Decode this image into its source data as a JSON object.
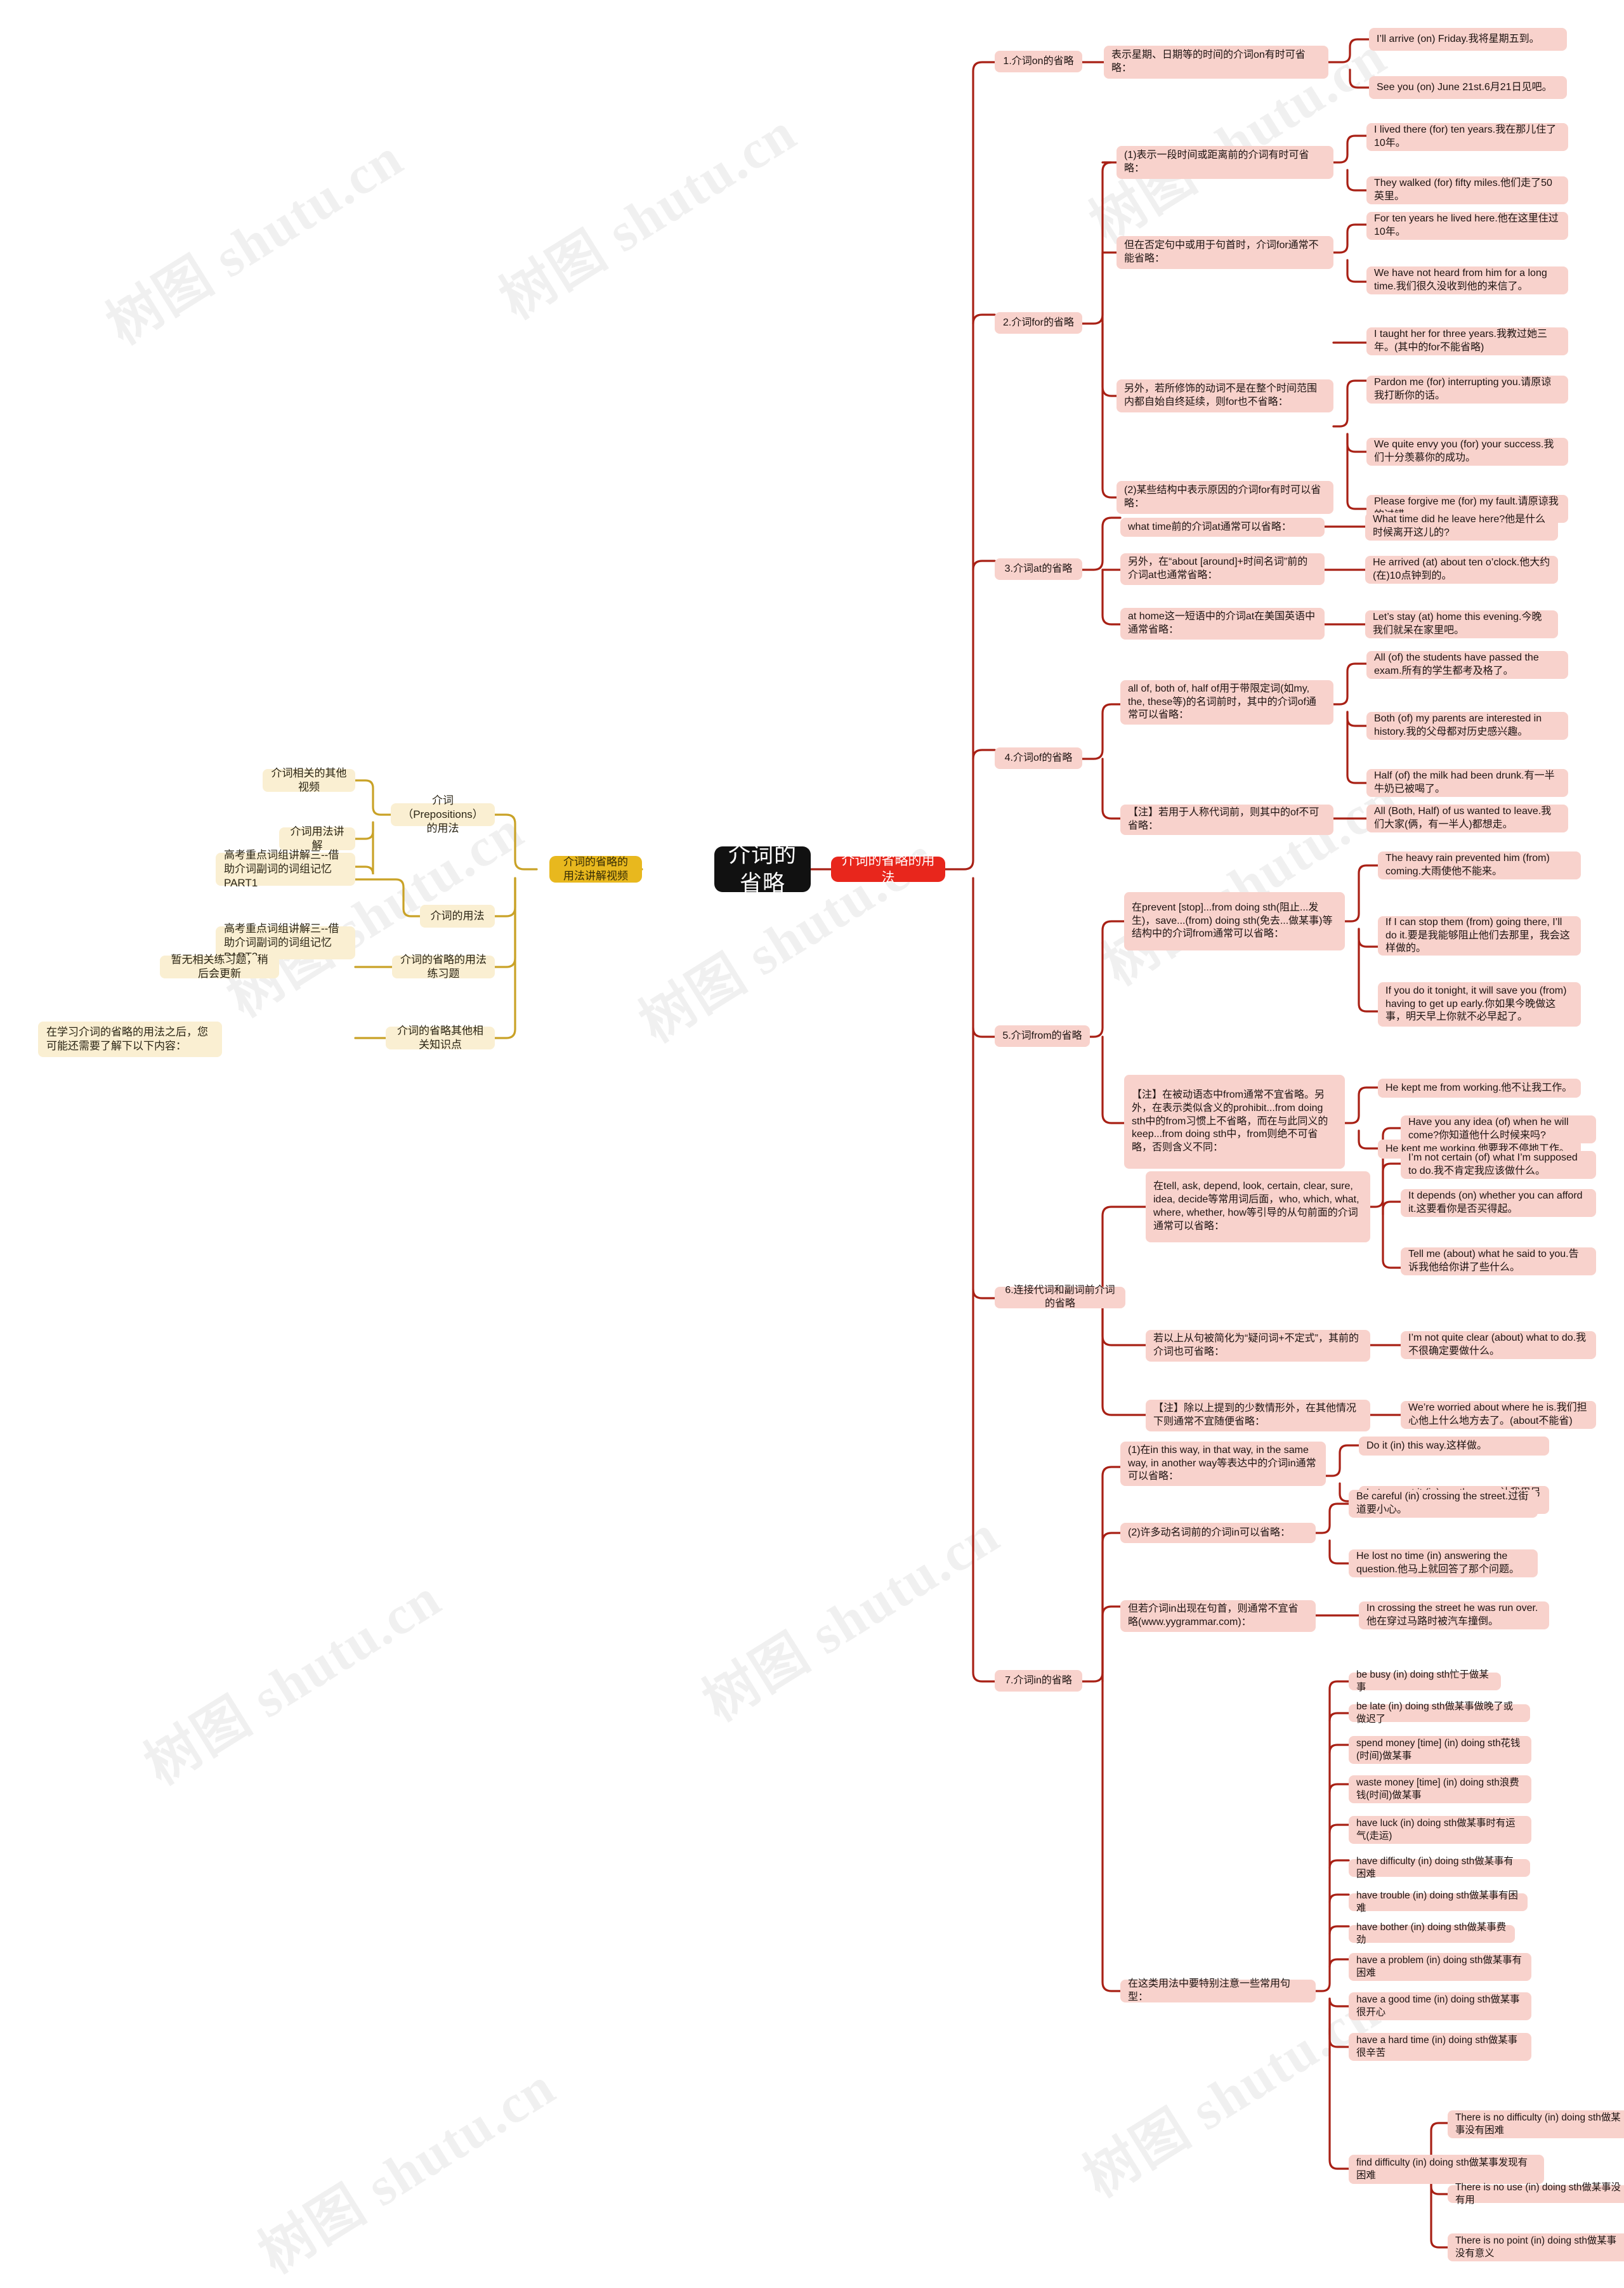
{
  "meta": {
    "title": "介词的省略",
    "watermark": "树图 shutu.cn",
    "colors": {
      "root_bg": "#111111",
      "primary_red": "#E8261C",
      "accent_yellow": "#E8B81E",
      "cream": "#FAEFD2",
      "pink": "#F8D2CC",
      "red_link": "#A82015",
      "yellow_link": "#C9A227"
    }
  },
  "root": {
    "label": "介词的省略"
  },
  "left_branch": {
    "hub": {
      "label": "介词的省略的用法讲解视频"
    },
    "groups": [
      {
        "label": "介词（Prepositions）的用法",
        "children": [
          {
            "label": "介词相关的其他视频"
          },
          {
            "label": "介词用法讲解"
          },
          {
            "label": "高考重点词组讲解三--借助介词副词的词组记忆PART1"
          }
        ]
      },
      {
        "label": "介词的用法",
        "children": [
          {
            "label": "高考重点词组讲解三--借助介词副词的词组记忆PART2"
          }
        ]
      },
      {
        "label": "介词的省略的用法练习题",
        "children": [
          {
            "label": "暂无相关练习题，稍后会更新"
          }
        ]
      },
      {
        "label": "介词的省略其他相关知识点",
        "children": [
          {
            "label": "在学习介词的省略的用法之后，您可能还需要了解下以下内容："
          }
        ]
      }
    ]
  },
  "right_branch": {
    "hub": {
      "label": "介词的省略的用法"
    },
    "sections": [
      {
        "id": "s1",
        "label": "1.介词on的省略",
        "rules": [
          {
            "text": "表示星期、日期等的时间的介词on有时可省略：",
            "examples": [
              "I’ll arrive (on) Friday.我将星期五到。",
              "See you (on) June 21st.6月21日见吧。"
            ]
          }
        ]
      },
      {
        "id": "s2",
        "label": "2.介词for的省略",
        "rules": [
          {
            "text": "(1)表示一段时间或距离前的介词有时可省略：",
            "examples": [
              "I lived there (for) ten years.我在那儿住了10年。",
              "They walked (for) fifty miles.他们走了50英里。"
            ]
          },
          {
            "text": "但在否定句中或用于句首时，介词for通常不能省略：",
            "examples": [
              "For ten years he lived here.他在这里住过10年。",
              "We have not heard from him for a long time.我们很久没收到他的来信了。"
            ]
          },
          {
            "text": "另外，若所修饰的动词不是在整个时间范围内都自始自终延续，则for也不省略：",
            "examples": [
              "I taught her for three years.我教过她三年。(其中的for不能省略)"
            ]
          },
          {
            "text": "(2)某些结构中表示原因的介词for有时可以省略：",
            "examples": [
              "Pardon me (for) interrupting you.请原谅我打断你的话。",
              "We quite envy you (for) your success.我们十分羡慕你的成功。",
              "Please forgive me (for) my fault.请原谅我的过错。"
            ]
          }
        ]
      },
      {
        "id": "s3",
        "label": "3.介词at的省略",
        "rules": [
          {
            "text": "what time前的介词at通常可以省略：",
            "examples": [
              "What time did he leave here?他是什么时候离开这儿的?"
            ]
          },
          {
            "text": "另外，在“about [around]+时间名词”前的介词at也通常省略：",
            "examples": [
              "He arrived (at) about ten o’clock.他大约(在)10点钟到的。"
            ]
          },
          {
            "text": "at home这一短语中的介词at在美国英语中通常省略：",
            "examples": [
              "Let’s stay (at) home this evening.今晚我们就呆在家里吧。"
            ]
          }
        ]
      },
      {
        "id": "s4",
        "label": "4.介词of的省略",
        "rules": [
          {
            "text": "all of, both of, half of用于带限定词(如my, the, these等)的名词前时，其中的介词of通常可以省略：",
            "examples": [
              "All (of) the students have passed the exam.所有的学生都考及格了。",
              "Both (of) my parents are interested in history.我的父母都对历史感兴趣。",
              "Half (of) the milk had been drunk.有一半牛奶已被喝了。"
            ]
          },
          {
            "text": "【注】若用于人称代词前，则其中的of不可省略：",
            "examples": [
              "All (Both, Half) of us wanted to leave.我们大家(俩，有一半人)都想走。"
            ]
          }
        ]
      },
      {
        "id": "s5",
        "label": "5.介词from的省略",
        "rules": [
          {
            "text": "在prevent [stop]...from doing sth(阻止...发生)，save...(from) doing sth(免去...做某事)等结构中的介词from通常可以省略：",
            "examples": [
              "The heavy rain prevented him (from) coming.大雨使他不能来。",
              "If I can stop them (from) going there, I’ll do it.要是我能够阻止他们去那里，我会这样做的。",
              "If you do it tonight, it will save you (from) having to get up early.你如果今晚做这事，明天早上你就不必早起了。"
            ]
          },
          {
            "text": "【注】在被动语态中from通常不宜省略。另外，在表示类似含义的prohibit...from doing sth中的from习惯上不省略，而在与此同义的keep...from doing sth中，from则绝不可省略，否则含义不同：",
            "examples": [
              "He kept me from working.他不让我工作。",
              "He kept me working.他要我不停地工作。"
            ]
          }
        ]
      },
      {
        "id": "s6",
        "label": "6.连接代词和副词前介词的省略",
        "rules": [
          {
            "text": "在tell, ask, depend, look, certain, clear, sure, idea, decide等常用词后面，who, which, what, where, whether, how等引导的从句前面的介词通常可以省略：",
            "examples": [
              "Have you any idea (of) when he will come?你知道他什么时候来吗?",
              "I’m not certain (of) what I’m supposed to do.我不肯定我应该做什么。",
              "It depends (on) whether you can afford it.这要看你是否买得起。",
              "Tell me (about) what he said to you.告诉我他给你讲了些什么。"
            ]
          },
          {
            "text": "若以上从句被简化为“疑问词+不定式”，其前的介词也可省略：",
            "examples": [
              "I’m not quite clear (about) what to do.我不很确定要做什么。"
            ]
          },
          {
            "text": "【注】除以上提到的少数情形外，在其他情况下则通常不宜随便省略：",
            "examples": [
              "We’re worried about where he is.我们担心他上什么地方去了。(about不能省)"
            ]
          }
        ]
      },
      {
        "id": "s7",
        "label": "7.介词in的省略",
        "rules": [
          {
            "text": "(1)在in this way, in that way, in the same way, in another way等表达中的介词in通常可以省略：",
            "examples": [
              "Do it (in) this way.这样做。",
              "Let me put it (in) another way.让我用另一种方式解释。"
            ]
          },
          {
            "text": "(2)许多动名词前的介词in可以省略：",
            "examples": [
              "Be careful (in) crossing the street.过街道要小心。",
              "He lost no time (in) answering the question.他马上就回答了那个问题。"
            ]
          },
          {
            "text": "但若介词in出现在句首，则通常不宜省略(www.yygrammar.com)：",
            "examples": [
              "In crossing the street he was run over.他在穿过马路时被汽车撞倒。"
            ]
          },
          {
            "text": "在这类用法中要特别注意一些常用句型：",
            "examples": [
              "be busy (in) doing sth忙于做某事",
              "be late (in) doing sth做某事做晚了或做迟了",
              "spend money [time] (in) doing sth花钱(时间)做某事",
              "waste money [time] (in) doing sth浪费钱(时间)做某事",
              "have luck (in) doing sth做某事时有运气(走运)",
              "have difficulty (in) doing sth做某事有困难",
              "have trouble (in) doing sth做某事有困难",
              "have bother (in) doing sth做某事费劲",
              "have a problem (in) doing sth做某事有困难",
              "have a good time (in) doing sth做某事很开心",
              "have a hard time (in) doing sth做某事很辛苦"
            ],
            "nested": {
              "text": "find difficulty (in) doing sth做某事发现有困难",
              "examples": [
                "There is no difficulty (in) doing sth做某事没有困难",
                "There is no use (in) doing sth做某事没有用",
                "There is no point (in) doing sth做某事没有意义"
              ]
            }
          }
        ]
      }
    ]
  }
}
